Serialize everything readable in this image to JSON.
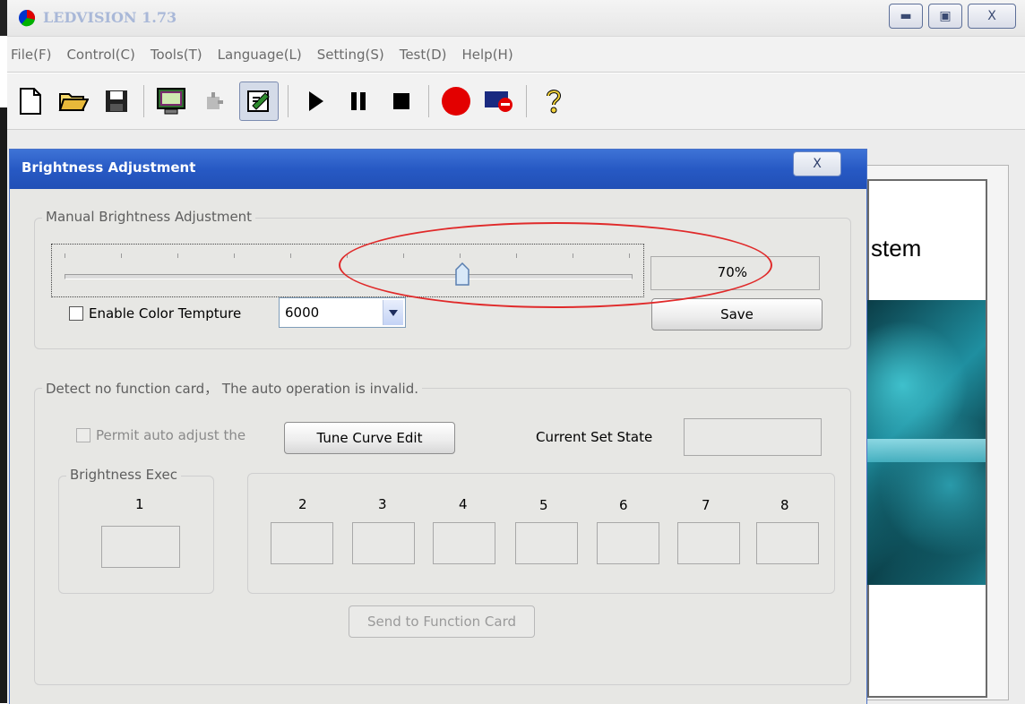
{
  "window": {
    "title": "LEDVISION 1.73",
    "controls": {
      "minimize": "▭",
      "maximize": "□",
      "close": "X"
    }
  },
  "menu": [
    "File(F)",
    "Control(C)",
    "Tools(T)",
    "Language(L)",
    "Setting(S)",
    "Test(D)",
    "Help(H)"
  ],
  "toolbar": {
    "icons": [
      "new-file-icon",
      "open-folder-icon",
      "save-floppy-icon",
      "display-monitor-icon",
      "plugin-icon",
      "brightness-edit-icon",
      "play-icon",
      "pause-icon",
      "stop-icon",
      "record-icon",
      "screen-off-icon",
      "help-question-icon"
    ]
  },
  "preview": {
    "text": "stem"
  },
  "dialog": {
    "title": "Brightness Adjustment",
    "close_label": "X",
    "manual": {
      "legend": "Manual Brightness Adjustment",
      "brightness_value": "70%",
      "brightness_percent": 70,
      "color_temp_label": "Enable Color Tempture",
      "color_temp_checked": false,
      "color_temp_value": "6000",
      "save_label": "Save"
    },
    "auto": {
      "legend": "Detect no function card， The auto operation is invalid.",
      "permit_label": "Permit auto adjust the",
      "tune_curve_label": "Tune Curve Edit",
      "current_state_label": "Current Set State",
      "current_state_value": "",
      "brightness_exec_legend": "Brightness Exec",
      "slots": [
        "1",
        "2",
        "3",
        "4",
        "5",
        "6",
        "7",
        "8"
      ],
      "send_label": "Send to Function Card"
    }
  },
  "colors": {
    "title_blue": "#2759c4",
    "annotation_red": "#e02a2a",
    "record_red": "#e30000"
  }
}
